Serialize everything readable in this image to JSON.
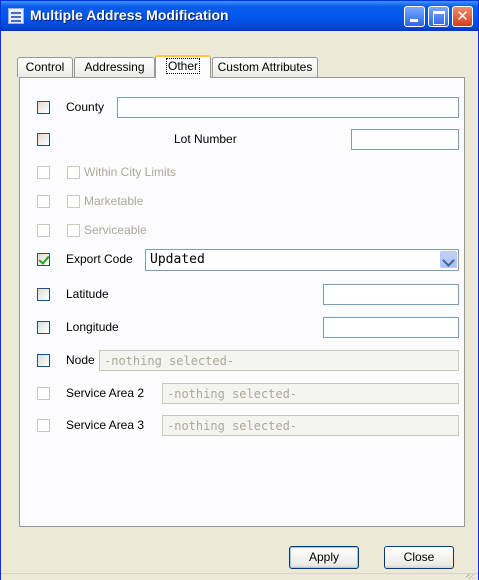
{
  "window": {
    "title": "Multiple Address Modification",
    "controls": {
      "minimize": "minimize",
      "maximize": "maximize",
      "close": "✕"
    }
  },
  "tabs": [
    {
      "label": "Control",
      "active": false
    },
    {
      "label": "Addressing",
      "active": false
    },
    {
      "label": "Other",
      "active": true
    },
    {
      "label": "Custom Attributes",
      "active": false
    }
  ],
  "fields": {
    "county": {
      "label": "County",
      "value": "",
      "checked": false
    },
    "lot_number": {
      "label": "Lot Number",
      "value": "",
      "checked": false
    },
    "within_city_limits": {
      "label": "Within City Limits",
      "checked": false,
      "enabled": false
    },
    "marketable": {
      "label": "Marketable",
      "checked": false,
      "enabled": false
    },
    "serviceable": {
      "label": "Serviceable",
      "checked": false,
      "enabled": false
    },
    "export_code": {
      "label": "Export Code",
      "value": "Updated",
      "checked": true
    },
    "latitude": {
      "label": "Latitude",
      "value": "",
      "checked": false
    },
    "longitude": {
      "label": "Longitude",
      "value": "",
      "checked": false
    },
    "node": {
      "label": "Node",
      "placeholder": "-nothing selected-",
      "checked": false
    },
    "service_area_2": {
      "label": "Service Area 2",
      "placeholder": "-nothing selected-",
      "checked": false,
      "enabled": false
    },
    "service_area_3": {
      "label": "Service Area 3",
      "placeholder": "-nothing selected-",
      "checked": false,
      "enabled": false
    }
  },
  "buttons": {
    "apply": "Apply",
    "close": "Close"
  },
  "colors": {
    "titlebar": "#0058EE",
    "dialog": "#ECE9D8",
    "panel": "#FCFCFE",
    "check": "#21A121",
    "active_tab": "#FFC83C"
  }
}
